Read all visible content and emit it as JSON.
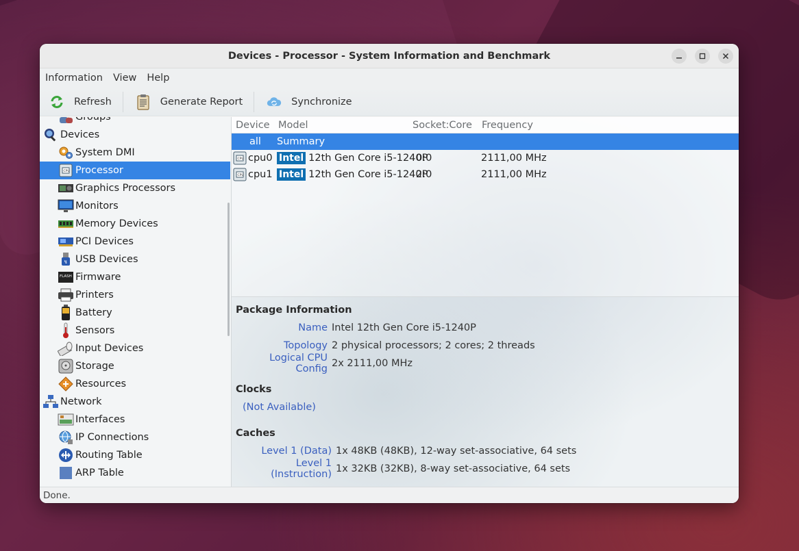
{
  "window": {
    "title": "Devices - Processor - System Information and Benchmark",
    "controls": {
      "minimize": "–",
      "maximize": "□",
      "close": "✕"
    }
  },
  "menu": [
    "Information",
    "View",
    "Help"
  ],
  "toolbar": {
    "refresh_label": "Refresh",
    "report_label": "Generate Report",
    "sync_label": "Synchronize"
  },
  "sidebar": {
    "items": [
      {
        "label": "Groups",
        "level": 1,
        "icon": "groups-icon"
      },
      {
        "label": "Devices",
        "level": 0,
        "icon": "devices-icon"
      },
      {
        "label": "System DMI",
        "level": 1,
        "icon": "system-dmi-icon"
      },
      {
        "label": "Processor",
        "level": 1,
        "icon": "processor-icon",
        "selected": true
      },
      {
        "label": "Graphics Processors",
        "level": 1,
        "icon": "gpu-icon"
      },
      {
        "label": "Monitors",
        "level": 1,
        "icon": "monitor-icon"
      },
      {
        "label": "Memory Devices",
        "level": 1,
        "icon": "memory-icon"
      },
      {
        "label": "PCI Devices",
        "level": 1,
        "icon": "pci-icon"
      },
      {
        "label": "USB Devices",
        "level": 1,
        "icon": "usb-icon"
      },
      {
        "label": "Firmware",
        "level": 1,
        "icon": "firmware-icon"
      },
      {
        "label": "Printers",
        "level": 1,
        "icon": "printer-icon"
      },
      {
        "label": "Battery",
        "level": 1,
        "icon": "battery-icon"
      },
      {
        "label": "Sensors",
        "level": 1,
        "icon": "sensor-icon"
      },
      {
        "label": "Input Devices",
        "level": 1,
        "icon": "input-icon"
      },
      {
        "label": "Storage",
        "level": 1,
        "icon": "storage-icon"
      },
      {
        "label": "Resources",
        "level": 1,
        "icon": "resources-icon"
      },
      {
        "label": "Network",
        "level": 0,
        "icon": "network-icon"
      },
      {
        "label": "Interfaces",
        "level": 1,
        "icon": "interfaces-icon"
      },
      {
        "label": "IP Connections",
        "level": 1,
        "icon": "ip-connections-icon"
      },
      {
        "label": "Routing Table",
        "level": 1,
        "icon": "routing-icon"
      },
      {
        "label": "ARP Table",
        "level": 1,
        "icon": "arp-icon"
      }
    ]
  },
  "table": {
    "headers": {
      "device": "Device",
      "model": "Model",
      "socket": "Socket:Core",
      "frequency": "Frequency"
    },
    "summary_row": {
      "device": "all",
      "model": "Summary"
    },
    "rows": [
      {
        "device": "cpu0",
        "vendor": "Intel",
        "model": "12th Gen Core i5-1240P",
        "socket": "0:0",
        "frequency": "2111,00 MHz"
      },
      {
        "device": "cpu1",
        "vendor": "Intel",
        "model": "12th Gen Core i5-1240P",
        "socket": "2:0",
        "frequency": "2111,00 MHz"
      }
    ]
  },
  "details": {
    "package_title": "Package Information",
    "package": [
      {
        "key": "Name",
        "value": "Intel 12th Gen Core i5-1240P"
      },
      {
        "key": "Topology",
        "value": "2 physical processors; 2 cores; 2 threads"
      },
      {
        "key": "Logical CPU Config",
        "value": "2x 2111,00 MHz"
      }
    ],
    "clocks_title": "Clocks",
    "clocks_value": "(Not Available)",
    "caches_title": "Caches",
    "caches": [
      {
        "key": "Level 1 (Data)",
        "value": "1x 48KB (48KB), 12-way set-associative, 64 sets"
      },
      {
        "key": "Level 1 (Instruction)",
        "value": "1x 32KB (32KB), 8-way set-associative, 64 sets"
      }
    ]
  },
  "status": "Done.",
  "colors": {
    "selection": "#3584e4",
    "intel_badge": "#0f6fb1",
    "key_text": "#3a5fbf"
  }
}
